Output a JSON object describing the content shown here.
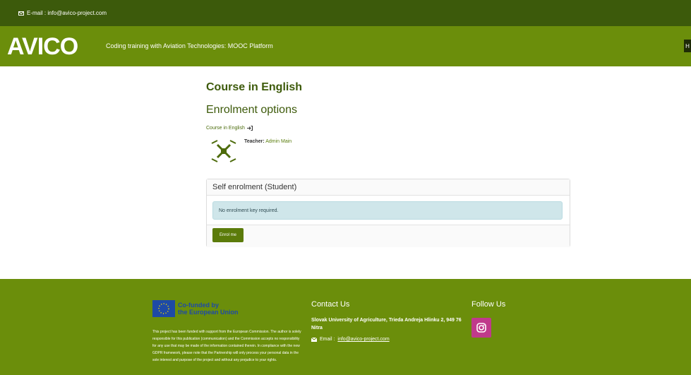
{
  "topbar": {
    "email_label": "E-mail : info@avico-project.com"
  },
  "header": {
    "logo_text": "AVICO",
    "tagline": "Coding training with Aviation Technologies: MOOC Platform",
    "nav_button": "H"
  },
  "course": {
    "title": "Course in English",
    "section_title": "Enrolment options",
    "link_label": "Course in English",
    "teacher_label": "Teacher:",
    "teacher_name": "Admin Main"
  },
  "enrolment": {
    "card_title": "Self enrolment (Student)",
    "notice": "No enrolment key required.",
    "button_label": "Enrol me"
  },
  "footer": {
    "eu_line1": "Co-funded by",
    "eu_line2": "the European Union",
    "disclaimer": "This project has been funded with support from the European Commission. The author is solely responsible for this publication (communication) and the Commission accepts no responsibility for any use that may be made of the information contained therein. In compliance with the new GDPR framework, please note that the Partnership will only process your personal data in the sole interest and purpose of the project and without any prejudice to your rights.",
    "contact_title": "Contact Us",
    "address": "Slovak University of Agriculture, Trieda Andreja Hlinku 2, 949 76 Nitra",
    "email_label": "Email :",
    "email_link": "info@avico-project.com",
    "follow_title": "Follow Us"
  },
  "icons": {
    "mail": "envelope-icon",
    "enter": "enter-icon",
    "course_image": "drone-icon",
    "instagram": "instagram-icon"
  },
  "colors": {
    "topbar": "#3c5a0b",
    "header": "#6b8e0b",
    "heading": "#3d5a0a",
    "button": "#5b7b0a",
    "alert": "#cfe6ea",
    "instagram": "#c03a8b",
    "eu_blue": "#1e4aa6"
  }
}
